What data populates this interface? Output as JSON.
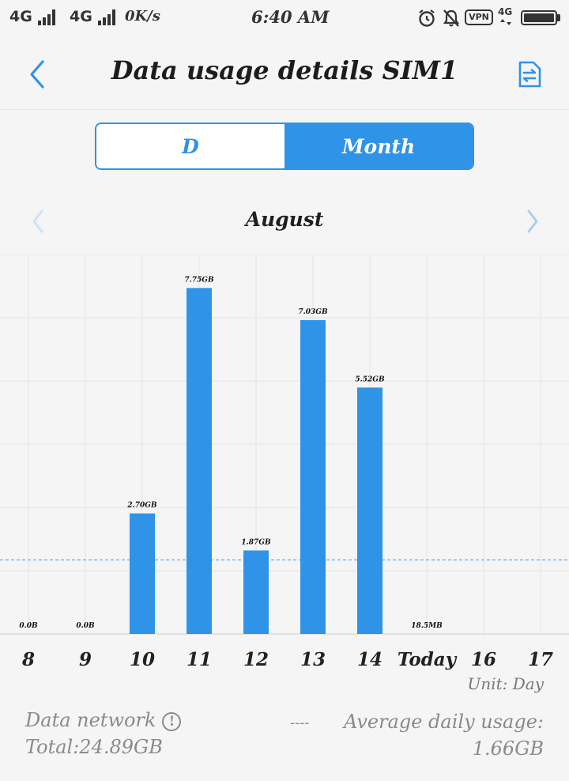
{
  "status_bar": {
    "net1": "4G",
    "net2": "4G",
    "speed": "0K/s",
    "time": "6:40 AM",
    "vpn": "VPN",
    "net3": "4G",
    "icons": [
      "signal-icon",
      "alarm-icon",
      "notifications-off-icon",
      "vpn-icon",
      "battery-icon"
    ]
  },
  "header": {
    "title": "Data usage details SIM1",
    "back_icon": "chevron-left-icon",
    "switch_icon": "swap-icon"
  },
  "segment": {
    "options": [
      "D",
      "Month"
    ],
    "selected": "Month"
  },
  "period": {
    "month": "August"
  },
  "chart_data": {
    "type": "bar",
    "categories": [
      "8",
      "9",
      "10",
      "11",
      "12",
      "13",
      "14",
      "Today",
      "16",
      "17"
    ],
    "values_gb": [
      0,
      0,
      2.7,
      7.75,
      1.87,
      7.03,
      5.52,
      0.0185,
      null,
      null
    ],
    "value_labels": [
      "0.0B",
      "0.0B",
      "2.70GB",
      "7.75GB",
      "1.87GB",
      "7.03GB",
      "5.52GB",
      "18.5MB",
      "",
      ""
    ],
    "average_line_gb": 1.66,
    "ylim": [
      0,
      8.5
    ],
    "grid": true,
    "color": "#2f93e8"
  },
  "unit_label": "Unit: Day",
  "footer": {
    "network_label": "Data network",
    "total": "Total:24.89GB",
    "dashes": "----",
    "average_label": "Average daily usage:",
    "average_value": "1.66GB"
  }
}
